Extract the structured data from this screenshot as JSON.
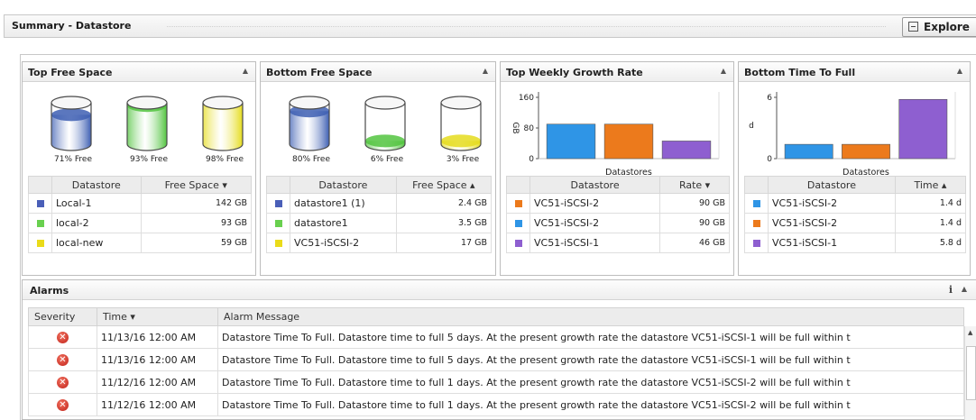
{
  "header": {
    "title": "Summary - Datastore",
    "explore_label": "Explore"
  },
  "panels": {
    "top_free_space": {
      "title": "Top Free Space",
      "cylinders": [
        {
          "label": "71% Free",
          "free_fraction": 0.71,
          "color": "#3e5fb3"
        },
        {
          "label": "93% Free",
          "free_fraction": 0.93,
          "color": "#52c43f"
        },
        {
          "label": "98% Free",
          "free_fraction": 0.98,
          "color": "#e5dc1d"
        }
      ],
      "columns": [
        "Datastore",
        "Free Space ▾"
      ],
      "rows": [
        {
          "color": "#4a5fb8",
          "name": "Local-1",
          "value": "142 GB"
        },
        {
          "color": "#69d04f",
          "name": "local-2",
          "value": "93 GB"
        },
        {
          "color": "#eadb1a",
          "name": "local-new",
          "value": "59 GB"
        }
      ]
    },
    "bottom_free_space": {
      "title": "Bottom Free Space",
      "cylinders": [
        {
          "label": "80% Free",
          "free_fraction": 0.8,
          "color": "#3e5fb3"
        },
        {
          "label": "6% Free",
          "free_fraction": 0.06,
          "color": "#52c43f"
        },
        {
          "label": "3% Free",
          "free_fraction": 0.03,
          "color": "#e5dc1d"
        }
      ],
      "columns": [
        "Datastore",
        "Free Space ▴"
      ],
      "rows": [
        {
          "color": "#4a5fb8",
          "name": "datastore1 (1)",
          "value": "2.4 GB"
        },
        {
          "color": "#69d04f",
          "name": "datastore1",
          "value": "3.5 GB"
        },
        {
          "color": "#eadb1a",
          "name": "VC51-iSCSI-2",
          "value": "17 GB"
        }
      ]
    },
    "top_weekly_growth": {
      "title": "Top Weekly Growth Rate",
      "columns": [
        "Datastore",
        "Rate ▾"
      ],
      "rows": [
        {
          "color": "#ec7a1c",
          "name": "VC51-iSCSI-2",
          "value": "90 GB"
        },
        {
          "color": "#2f95e6",
          "name": "VC51-iSCSI-2",
          "value": "90 GB"
        },
        {
          "color": "#8e5fd0",
          "name": "VC51-iSCSI-1",
          "value": "46 GB"
        }
      ]
    },
    "bottom_time_to_full": {
      "title": "Bottom Time To Full",
      "columns": [
        "Datastore",
        "Time ▴"
      ],
      "rows": [
        {
          "color": "#2f95e6",
          "name": "VC51-iSCSI-2",
          "value": "1.4 d"
        },
        {
          "color": "#ec7a1c",
          "name": "VC51-iSCSI-2",
          "value": "1.4 d"
        },
        {
          "color": "#8e5fd0",
          "name": "VC51-iSCSI-1",
          "value": "5.8 d"
        }
      ]
    }
  },
  "chart_data": [
    {
      "type": "bar",
      "title": "Top Weekly Growth Rate",
      "xlabel": "Datastores",
      "ylabel": "GB",
      "yticks": [
        0,
        80,
        160
      ],
      "ylim": [
        0,
        160
      ],
      "categories": [
        "VC51-iSCSI-2",
        "VC51-iSCSI-2",
        "VC51-iSCSI-1"
      ],
      "values": [
        90,
        90,
        46
      ],
      "colors": [
        "#2f95e6",
        "#ec7a1c",
        "#8e5fd0"
      ],
      "grid": false
    },
    {
      "type": "bar",
      "title": "Bottom Time To Full",
      "xlabel": "Datastores",
      "ylabel": "d",
      "yticks": [
        0,
        6
      ],
      "ylim": [
        0,
        6
      ],
      "categories": [
        "VC51-iSCSI-2",
        "VC51-iSCSI-2",
        "VC51-iSCSI-1"
      ],
      "values": [
        1.4,
        1.4,
        5.8
      ],
      "colors": [
        "#2f95e6",
        "#ec7a1c",
        "#8e5fd0"
      ],
      "grid": false
    }
  ],
  "alarms": {
    "title": "Alarms",
    "info_label": "i",
    "columns": [
      "Severity",
      "Time ▾",
      "Alarm Message"
    ],
    "rows": [
      {
        "severity": "error",
        "time": "11/13/16 12:00 AM",
        "message": "Datastore Time To Full. Datastore time to full 5 days. At the present growth rate the datastore VC51-iSCSI-1 will be full within t"
      },
      {
        "severity": "error",
        "time": "11/13/16 12:00 AM",
        "message": "Datastore Time To Full. Datastore time to full 5 days. At the present growth rate the datastore VC51-iSCSI-1 will be full within t"
      },
      {
        "severity": "error",
        "time": "11/12/16 12:00 AM",
        "message": "Datastore Time To Full. Datastore time to full 1 days. At the present growth rate the datastore VC51-iSCSI-2 will be full within t"
      },
      {
        "severity": "error",
        "time": "11/12/16 12:00 AM",
        "message": "Datastore Time To Full. Datastore time to full 1 days. At the present growth rate the datastore VC51-iSCSI-2 will be full within t"
      }
    ]
  }
}
